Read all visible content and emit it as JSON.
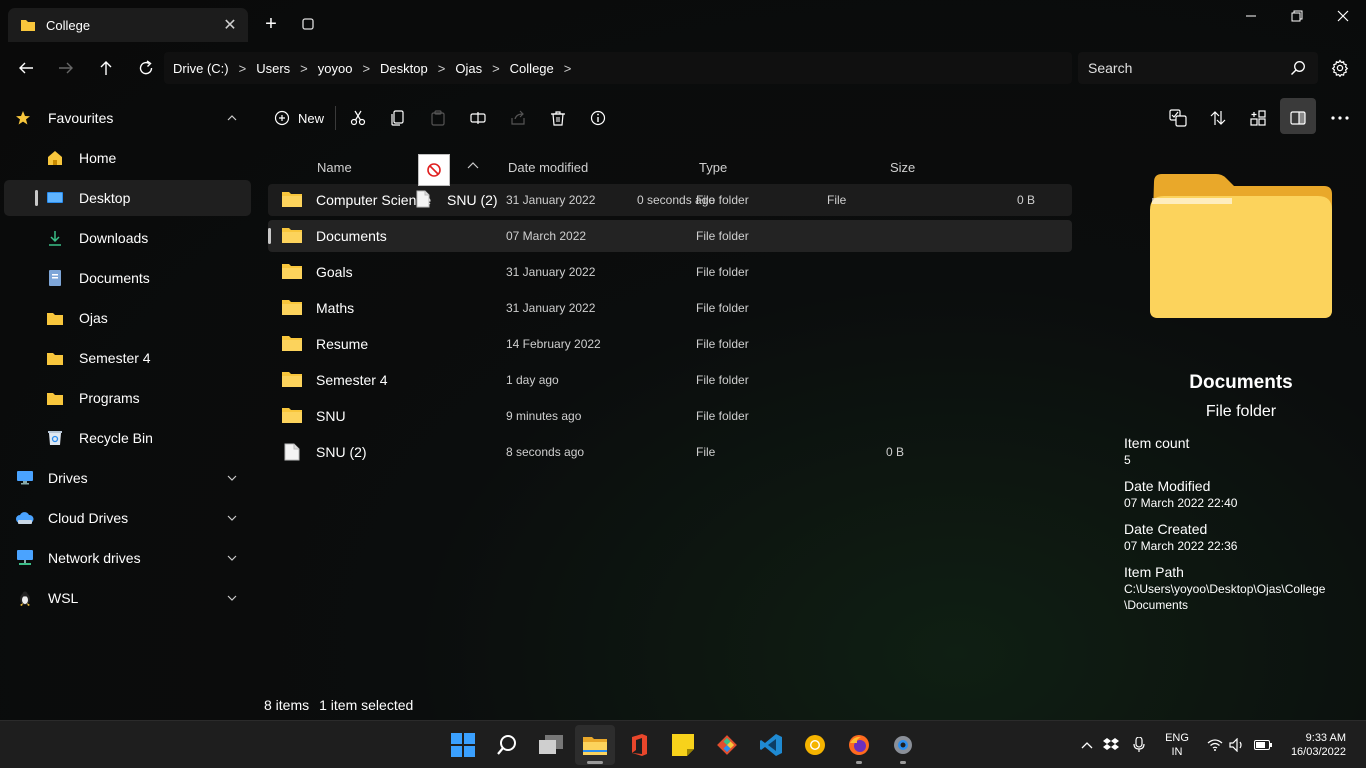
{
  "window": {
    "tab_title": "College",
    "tab_close": "✕",
    "new_tab": "+"
  },
  "nav": {
    "breadcrumb": [
      "Drive (C:)",
      "Users",
      "yoyoo",
      "Desktop",
      "Ojas",
      "College"
    ],
    "separator": ">",
    "search_placeholder": "Search"
  },
  "sidebar": {
    "items": [
      {
        "label": "Favourites",
        "icon": "star-icon",
        "expanded": true
      },
      {
        "label": "Home",
        "icon": "home-icon"
      },
      {
        "label": "Desktop",
        "icon": "desktop-icon",
        "selected": true
      },
      {
        "label": "Downloads",
        "icon": "download-icon"
      },
      {
        "label": "Documents",
        "icon": "document-icon"
      },
      {
        "label": "Ojas",
        "icon": "folder-icon"
      },
      {
        "label": "Semester 4",
        "icon": "folder-icon"
      },
      {
        "label": "Programs",
        "icon": "folder-icon"
      },
      {
        "label": "Recycle Bin",
        "icon": "recycle-bin-icon"
      },
      {
        "label": "Drives",
        "icon": "monitor-icon",
        "expanded": false
      },
      {
        "label": "Cloud Drives",
        "icon": "cloud-drive-icon",
        "expanded": false
      },
      {
        "label": "Network drives",
        "icon": "network-icon",
        "expanded": false
      },
      {
        "label": "WSL",
        "icon": "linux-icon",
        "expanded": false
      }
    ]
  },
  "toolbar": {
    "new_label": "New"
  },
  "columns": {
    "name": "Name",
    "date_modified": "Date modified",
    "type": "Type",
    "size": "Size"
  },
  "files": [
    {
      "name": "Computer Science",
      "date": "31 January 2022",
      "type": "File folder",
      "size": "",
      "kind": "folder"
    },
    {
      "name": "Documents",
      "date": "07 March 2022",
      "type": "File folder",
      "size": "",
      "kind": "folder",
      "selected": true
    },
    {
      "name": "Goals",
      "date": "31 January 2022",
      "type": "File folder",
      "size": "",
      "kind": "folder"
    },
    {
      "name": "Maths",
      "date": "31 January 2022",
      "type": "File folder",
      "size": "",
      "kind": "folder"
    },
    {
      "name": "Resume",
      "date": "14 February 2022",
      "type": "File folder",
      "size": "",
      "kind": "folder"
    },
    {
      "name": "Semester 4",
      "date": "1 day ago",
      "type": "File folder",
      "size": "",
      "kind": "folder"
    },
    {
      "name": "SNU",
      "date": "9 minutes ago",
      "type": "File folder",
      "size": "",
      "kind": "folder"
    },
    {
      "name": "SNU (2)",
      "date": "8 seconds ago",
      "type": "File",
      "size": "0 B",
      "kind": "file"
    }
  ],
  "drag_ghost": {
    "name": "SNU (2)",
    "date": "0 seconds ago",
    "type": "File",
    "size": "0 B"
  },
  "status": {
    "item_count": "8 items",
    "selection": "1 item selected"
  },
  "preview": {
    "title": "Documents",
    "subtitle": "File folder",
    "properties": [
      {
        "label": "Item count",
        "value": "5"
      },
      {
        "label": "Date Modified",
        "value": "07 March 2022 22:40"
      },
      {
        "label": "Date Created",
        "value": "07 March 2022 22:36"
      },
      {
        "label": "Item Path",
        "value": "C:\\Users\\yoyoo\\Desktop\\Ojas\\College",
        "value2": "\\Documents"
      }
    ]
  },
  "taskbar": {
    "apps": [
      "start-button",
      "search",
      "task-view",
      "file-explorer",
      "office",
      "sticky-notes",
      "git",
      "vscode",
      "chrome-canary",
      "firefox",
      "settings"
    ],
    "language_line1": "ENG",
    "language_line2": "IN",
    "time": "9:33 AM",
    "date": "16/03/2022"
  },
  "colors": {
    "folder_yellow": "#f8c63c",
    "selection_bg": "#232323",
    "taskbar_bg": "#1e1e1e",
    "accent_blue": "#2b8ef0"
  }
}
